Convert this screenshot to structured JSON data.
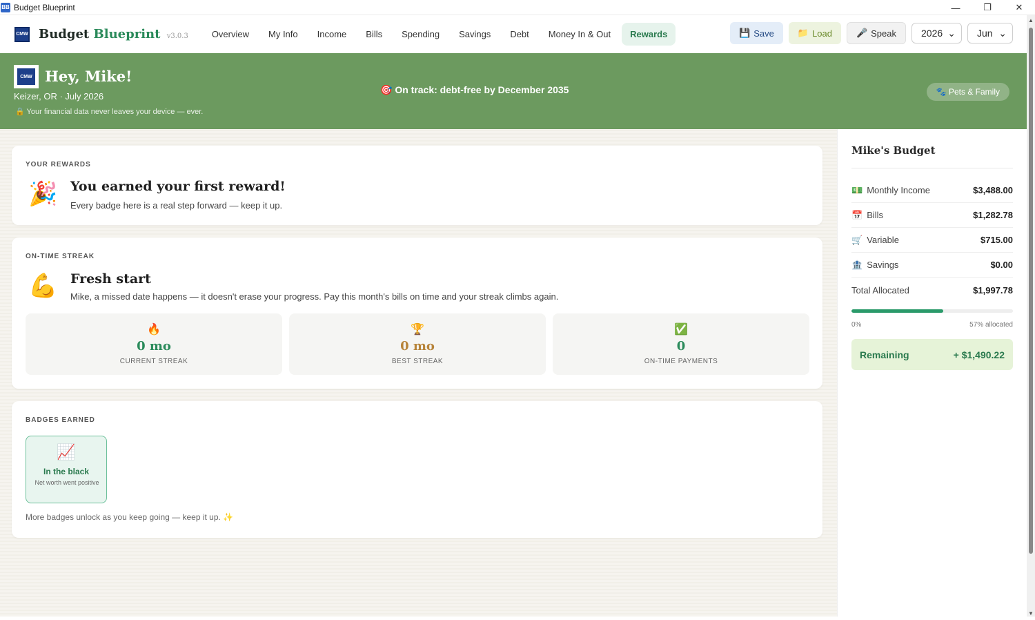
{
  "window": {
    "title": "Budget Blueprint",
    "icon_text": "BB",
    "minimize": "—",
    "restore": "❐",
    "close": "✕"
  },
  "nav": {
    "logo_text": "CMW",
    "brand_main": "Budget",
    "brand_accent": "Blueprint",
    "version": "v3.0.3",
    "tabs": [
      "Overview",
      "My Info",
      "Income",
      "Bills",
      "Spending",
      "Savings",
      "Debt",
      "Money In & Out",
      "Rewards"
    ],
    "active_tab": "Rewards",
    "save_label": "Save",
    "load_label": "Load",
    "speak_label": "Speak",
    "year": "2026",
    "month": "Jun"
  },
  "hero": {
    "logo_text": "CMW",
    "greeting": "Hey, Mike!",
    "location": "Keizer, OR · July 2026",
    "privacy": "🔒 Your financial data never leaves your device — ever.",
    "status": "🎯 On track: debt-free by December 2035",
    "pets_button": "🐾 Pets & Family"
  },
  "rewards": {
    "label": "YOUR REWARDS",
    "emoji": "🎉",
    "heading": "You earned your first reward!",
    "sub": "Every badge here is a real step forward — keep it up."
  },
  "streak": {
    "label": "ON-TIME STREAK",
    "emoji": "💪",
    "heading": "Fresh start",
    "sub": "Mike, a missed date happens — it doesn't erase your progress. Pay this month's bills on time and your streak climbs again.",
    "stats": [
      {
        "icon": "🔥",
        "value": "0 mo",
        "label": "CURRENT STREAK"
      },
      {
        "icon": "🏆",
        "value": "0 mo",
        "label": "BEST STREAK"
      },
      {
        "icon": "✅",
        "value": "0",
        "label": "ON-TIME PAYMENTS"
      }
    ]
  },
  "badges": {
    "label": "BADGES EARNED",
    "items": [
      {
        "icon": "📈",
        "title": "In the black",
        "desc": "Net worth went positive"
      }
    ],
    "more": "More badges unlock as you keep going — keep it up. ✨"
  },
  "sidebar": {
    "title": "Mike's Budget",
    "rows": [
      {
        "icon": "💵",
        "label": "Monthly Income",
        "value": "$3,488.00"
      },
      {
        "icon": "📅",
        "label": "Bills",
        "value": "$1,282.78"
      },
      {
        "icon": "🛒",
        "label": "Variable",
        "value": "$715.00"
      },
      {
        "icon": "🏦",
        "label": "Savings",
        "value": "$0.00"
      }
    ],
    "total_label": "Total Allocated",
    "total_value": "$1,997.78",
    "progress_fraction": 0.57,
    "progress_left": "0%",
    "progress_right": "57% allocated",
    "remaining_label": "Remaining",
    "remaining_value": "+ $1,490.22"
  },
  "colors": {
    "hero_bg": "#6c9a5f",
    "accent_green": "#2a8a5a",
    "remaining_bg": "#e6f3d8"
  }
}
